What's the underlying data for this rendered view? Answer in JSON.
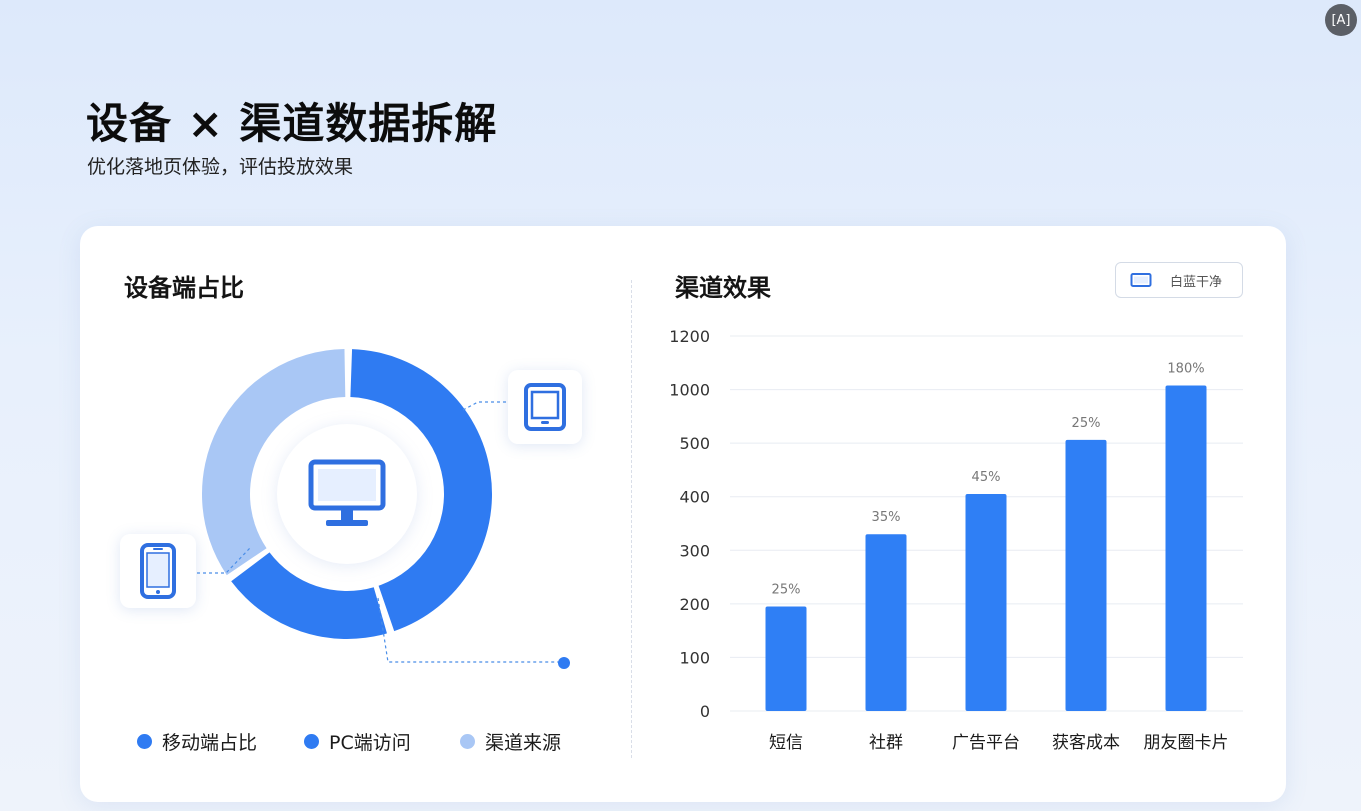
{
  "header": {
    "title": "设备 × 渠道数据拆解",
    "subtitle": "优化落地页体验，评估投放效果"
  },
  "corner_button": {
    "label": "[A]"
  },
  "theme_button": {
    "label": "白蓝干净"
  },
  "colors": {
    "primary": "#2f7bf2",
    "light": "#a9c7f5",
    "grid": "#e8ecf2",
    "bar": "#2f7ff5"
  },
  "chart_data": [
    {
      "type": "pie",
      "title": "设备端占比",
      "donut": true,
      "series": [
        {
          "name": "移动端占比",
          "value": 20,
          "color": "#2f7bf2"
        },
        {
          "name": "PC端访问",
          "value": 45,
          "color": "#2f7bf2"
        },
        {
          "name": "渠道来源",
          "value": 35,
          "color": "#a9c7f5"
        }
      ],
      "legend": "bottom",
      "icons": [
        "desktop-icon",
        "tablet-icon",
        "phone-icon"
      ]
    },
    {
      "type": "bar",
      "title": "渠道效果",
      "categories": [
        "短信",
        "社群",
        "广告平台",
        "获客成本",
        "朋友圈卡片"
      ],
      "values": [
        195,
        330,
        405,
        530,
        1015
      ],
      "data_labels": [
        "25%",
        "35%",
        "45%",
        "25%",
        "180%"
      ],
      "y_ticks": [
        "0",
        "100",
        "200",
        "300",
        "400",
        "500",
        "1000",
        "1200"
      ],
      "ylim": [
        0,
        1200
      ],
      "grid": true,
      "legend": "none"
    }
  ]
}
